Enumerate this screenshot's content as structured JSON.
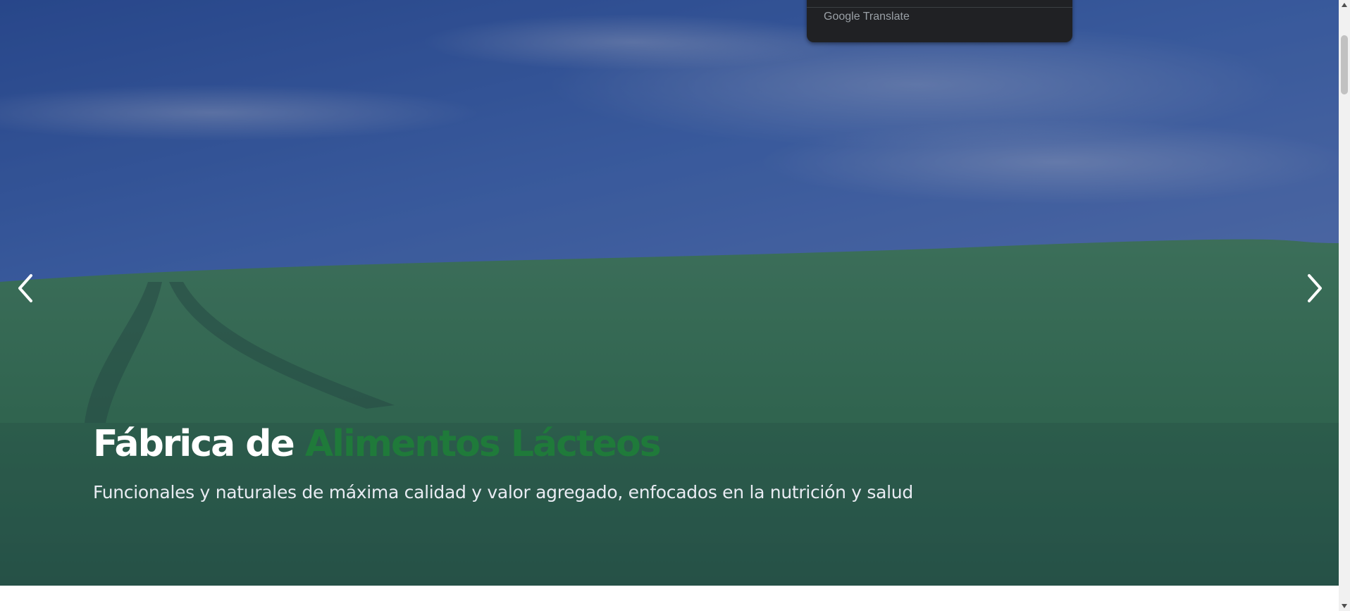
{
  "translate_popup": {
    "brand_google": "Google",
    "brand_translate": "Translate"
  },
  "hero": {
    "title_plain": "Fábrica de ",
    "title_accent": "Alimentos Lácteos",
    "subtitle": "Funcionales y naturales de máxima calidad y valor agregado, enfocados en la nutrición y salud",
    "accent_color": "#1f7a3a",
    "prev_icon": "chevron-left-icon",
    "next_icon": "chevron-right-icon"
  },
  "scrollbar": {
    "up_icon": "arrow-up-icon",
    "down_icon": "arrow-down-icon"
  }
}
